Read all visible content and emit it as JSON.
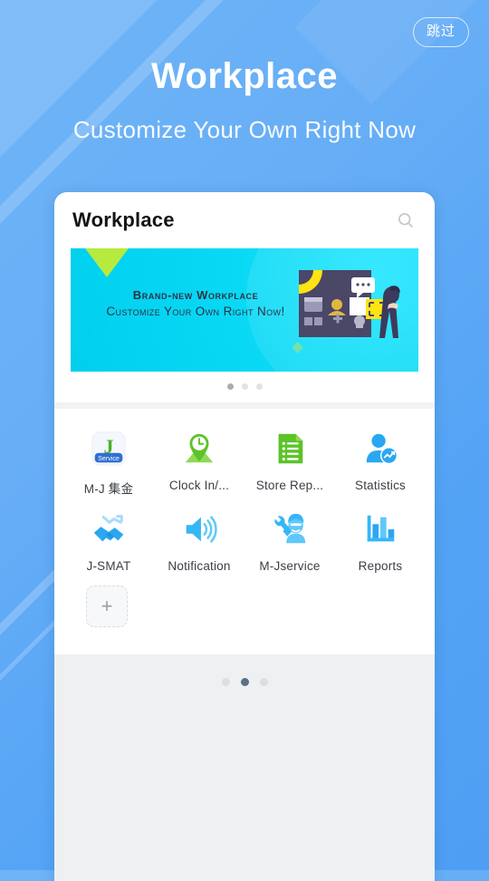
{
  "hero": {
    "title": "Workplace",
    "subtitle": "Customize Your Own Right Now",
    "skip_label": "跳过"
  },
  "colors": {
    "background_blue": "#53a3f5",
    "banner_cyan": "#0ad9f5",
    "banner_corner_green": "#b6ea3e",
    "icon_green": "#5cc328",
    "icon_blue": "#2aa7f2",
    "icon_light_blue": "#5fc8fb",
    "active_dot": "#5d7186",
    "text_dark": "#121417"
  },
  "phone": {
    "card_title": "Workplace",
    "search_icon": "search-icon",
    "banner": {
      "line1": "Brand-new Workplace",
      "line2": "Customize Your Own Right Now!",
      "dots_total": 3,
      "dots_active_index": 0
    },
    "apps": [
      {
        "label": "M-J 集金",
        "icon": "j-service-icon"
      },
      {
        "label": "Clock In/...",
        "icon": "clock-location-pin-icon"
      },
      {
        "label": "Store Rep...",
        "icon": "document-list-icon"
      },
      {
        "label": "Statistics",
        "icon": "person-chart-icon"
      },
      {
        "label": "J-SMAT",
        "icon": "handshake-growth-icon"
      },
      {
        "label": "Notification",
        "icon": "speaker-icon"
      },
      {
        "label": "M-Jservice",
        "icon": "wrench-worker-icon"
      },
      {
        "label": "Reports",
        "icon": "bar-chart-icon"
      }
    ],
    "add_tile": {
      "label": "+",
      "icon": "plus-icon"
    },
    "page_dots": {
      "total": 3,
      "active_index": 1
    }
  }
}
